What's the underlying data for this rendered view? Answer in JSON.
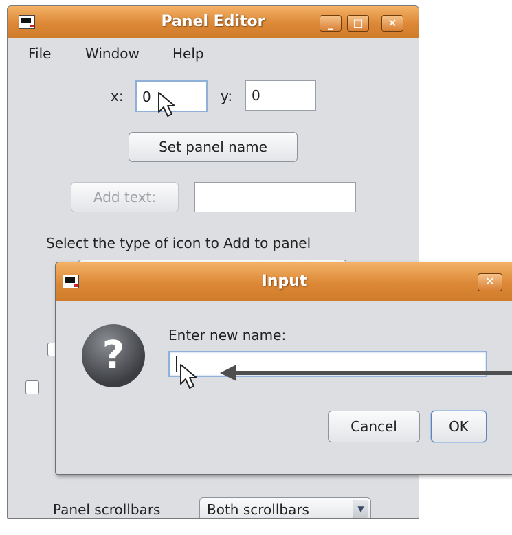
{
  "main_window": {
    "title": "Panel Editor",
    "controls": {
      "minimize": "_",
      "maximize": "□",
      "close": "✕"
    },
    "menu": [
      "File",
      "Window",
      "Help"
    ],
    "x_label": "x:",
    "x_value": "0",
    "y_label": "y:",
    "y_value": "0",
    "set_panel_name_label": "Set panel name",
    "add_text_label": "Add text:",
    "add_text_value": "",
    "icon_type_prompt": "Select the type of icon to Add to panel",
    "scrollbars_label": "Panel scrollbars",
    "scrollbars_value": "Both scrollbars"
  },
  "input_dialog": {
    "title": "Input",
    "close": "✕",
    "question_icon": "question-icon",
    "prompt": "Enter new name:",
    "value": "",
    "cancel_label": "Cancel",
    "ok_label": "OK"
  },
  "colors": {
    "titlebar": "#dc8836",
    "window_bg": "#dcdee2",
    "annotation_arrow": "#4f4f4f"
  }
}
